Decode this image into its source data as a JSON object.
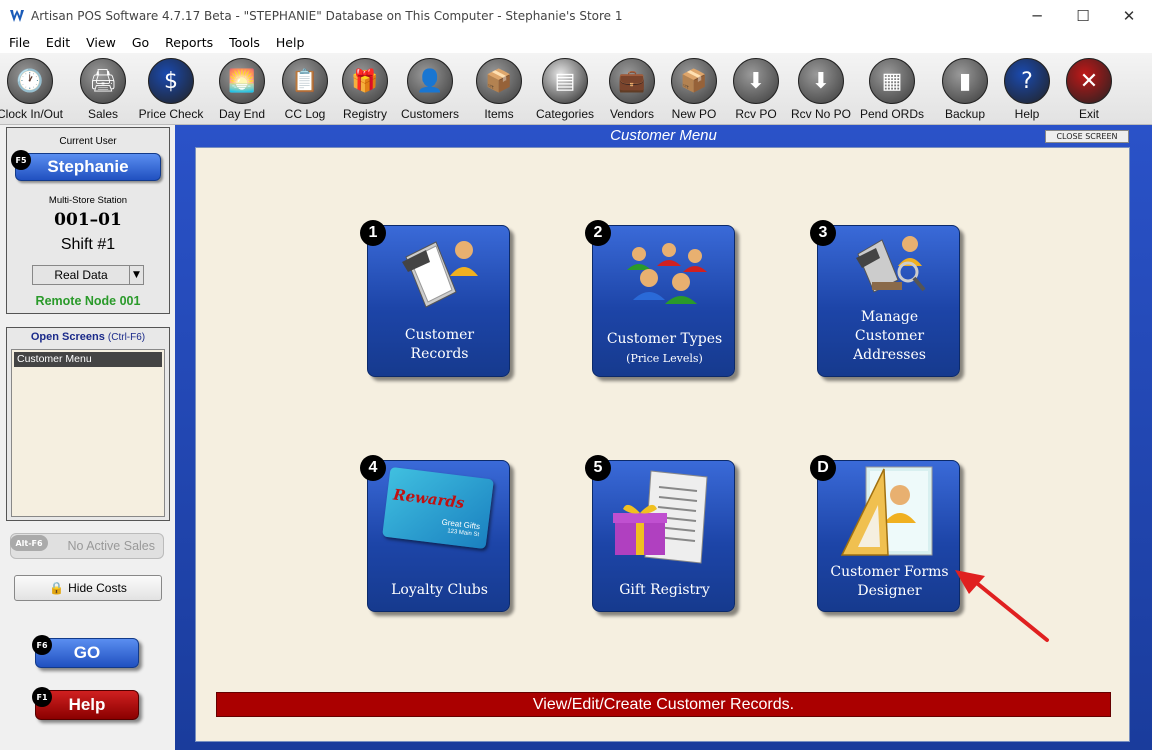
{
  "window": {
    "title": "Artisan POS Software 4.7.17 Beta - \"STEPHANIE\" Database on This Computer - Stephanie's Store 1",
    "minimize": "─",
    "maximize": "☐",
    "close": "✕"
  },
  "menu": [
    "File",
    "Edit",
    "View",
    "Go",
    "Reports",
    "Tools",
    "Help"
  ],
  "toolbar": [
    {
      "label": "Clock In/Out",
      "icon": "clock-icon",
      "glyph": "🕐"
    },
    {
      "label": "Sales",
      "icon": "register-icon",
      "glyph": "🖨"
    },
    {
      "label": "Price Check",
      "icon": "dollar-icon",
      "glyph": "$"
    },
    {
      "label": "Day End",
      "icon": "sunset-icon",
      "glyph": "🌅"
    },
    {
      "label": "CC Log",
      "icon": "log-icon",
      "glyph": "📋"
    },
    {
      "label": "Registry",
      "icon": "gift-icon",
      "glyph": "🎁"
    },
    {
      "label": "Customers",
      "icon": "customer-icon",
      "glyph": "👤"
    },
    {
      "label": "Items",
      "icon": "items-icon",
      "glyph": "📦"
    },
    {
      "label": "Categories",
      "icon": "categories-icon",
      "glyph": "▤"
    },
    {
      "label": "Vendors",
      "icon": "vendor-icon",
      "glyph": "💼"
    },
    {
      "label": "New PO",
      "icon": "box-icon",
      "glyph": "📦"
    },
    {
      "label": "Rcv PO",
      "icon": "receive-icon",
      "glyph": "⬇"
    },
    {
      "label": "Rcv No PO",
      "icon": "receive-nopo-icon",
      "glyph": "⬇"
    },
    {
      "label": "Pend ORDs",
      "icon": "pending-icon",
      "glyph": "▦"
    },
    {
      "label": "Backup",
      "icon": "usb-icon",
      "glyph": "▮"
    },
    {
      "label": "Help",
      "icon": "help-icon",
      "glyph": "?"
    },
    {
      "label": "Exit",
      "icon": "exit-icon",
      "glyph": "✕"
    }
  ],
  "left": {
    "current_user_label": "Current User",
    "user_key": "F5",
    "user_name": "Stephanie",
    "station_label": "Multi-Store Station",
    "station_id": "001–01",
    "shift": "Shift #1",
    "data_select": "Real Data",
    "remote_node": "Remote Node 001",
    "open_screens_label": "Open Screens",
    "open_screens_shortcut": "(Ctrl-F6)",
    "open_screens": [
      "Customer Menu"
    ],
    "active_sales_key": "Alt-F6",
    "active_sales": "No Active Sales",
    "hide_costs": "Hide Costs",
    "go_key": "F6",
    "go": "GO",
    "help_key": "F1",
    "help": "Help"
  },
  "main": {
    "title": "Customer Menu",
    "close_screen": "CLOSE SCREEN",
    "status": "View/Edit/Create Customer Records.",
    "tiles": [
      {
        "num": "1",
        "line1": "Customer",
        "line2": "Records",
        "line3": ""
      },
      {
        "num": "2",
        "line1": "Customer Types",
        "line2": "(Price Levels)",
        "line3": ""
      },
      {
        "num": "3",
        "line1": "Manage",
        "line2": "Customer",
        "line3": "Addresses"
      },
      {
        "num": "4",
        "line1": "Loyalty Clubs",
        "line2": "",
        "line3": ""
      },
      {
        "num": "5",
        "line1": "Gift Registry",
        "line2": "",
        "line3": ""
      },
      {
        "num": "D",
        "line1": "Customer Forms",
        "line2": "Designer",
        "line3": ""
      }
    ],
    "rewards_card_text": "Rewards",
    "rewards_card_sub": "Great Gifts",
    "rewards_card_addr": "123 Main St"
  }
}
